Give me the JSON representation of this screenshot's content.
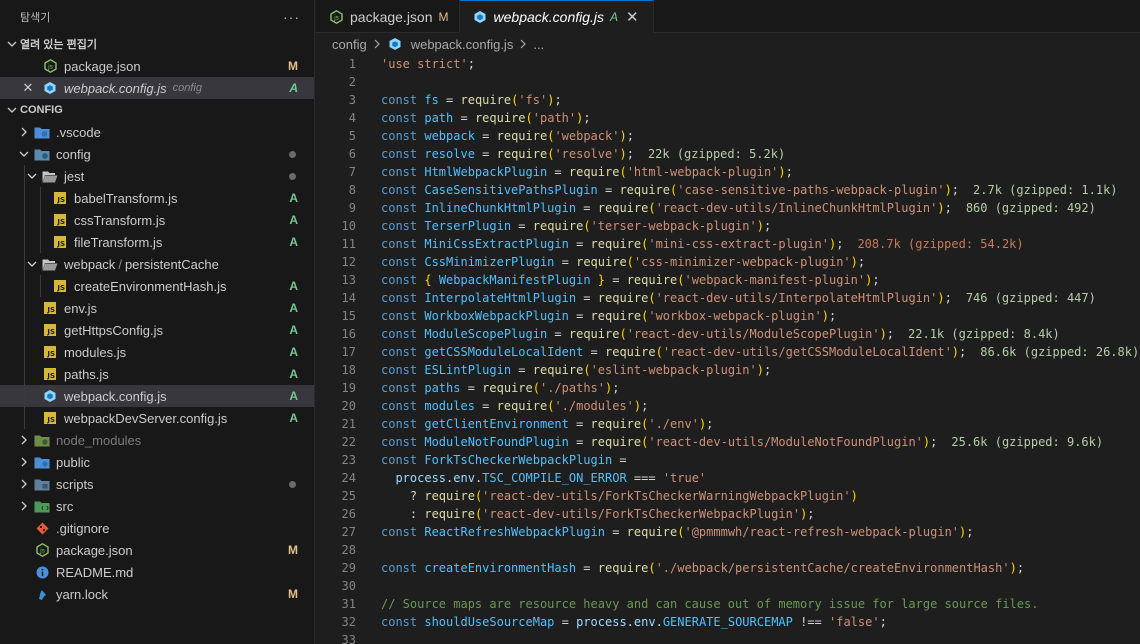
{
  "sidebar": {
    "title": "탐색기",
    "open_editors_label": "열려 있는 편집기",
    "open_editors": [
      {
        "label": "package.json",
        "sub": "",
        "badge": "M"
      },
      {
        "label": "webpack.config.js",
        "sub": "config",
        "badge": "A"
      }
    ],
    "project_label": "CONFIG",
    "tree": [
      {
        "label": ".vscode",
        "badge": ""
      },
      {
        "label": "config",
        "badge": ""
      },
      {
        "label": "jest",
        "badge": ""
      },
      {
        "label": "babelTransform.js",
        "badge": "A"
      },
      {
        "label": "cssTransform.js",
        "badge": "A"
      },
      {
        "label": "fileTransform.js",
        "badge": "A"
      },
      {
        "label": "webpack",
        "label2": "persistentCache",
        "badge": ""
      },
      {
        "label": "createEnvironmentHash.js",
        "badge": "A"
      },
      {
        "label": "env.js",
        "badge": "A"
      },
      {
        "label": "getHttpsConfig.js",
        "badge": "A"
      },
      {
        "label": "modules.js",
        "badge": "A"
      },
      {
        "label": "paths.js",
        "badge": "A"
      },
      {
        "label": "webpack.config.js",
        "badge": "A"
      },
      {
        "label": "webpackDevServer.config.js",
        "badge": "A"
      },
      {
        "label": "node_modules",
        "badge": ""
      },
      {
        "label": "public",
        "badge": ""
      },
      {
        "label": "scripts",
        "badge": ""
      },
      {
        "label": "src",
        "badge": ""
      },
      {
        "label": ".gitignore",
        "badge": ""
      },
      {
        "label": "package.json",
        "badge": "M"
      },
      {
        "label": "README.md",
        "badge": ""
      },
      {
        "label": "yarn.lock",
        "badge": "M"
      }
    ]
  },
  "tabs": [
    {
      "label": "package.json",
      "status": "M"
    },
    {
      "label": "webpack.config.js",
      "status": "A"
    }
  ],
  "breadcrumb": {
    "folder": "config",
    "file": "webpack.config.js",
    "more": "..."
  },
  "editor": {
    "line_numbers": [
      "1",
      "2",
      "3",
      "4",
      "5",
      "6",
      "7",
      "8",
      "9",
      "10",
      "11",
      "12",
      "13",
      "14",
      "15",
      "16",
      "17",
      "18",
      "19",
      "20",
      "21",
      "22",
      "23",
      "24",
      "25",
      "26",
      "27",
      "28",
      "29",
      "30",
      "31",
      "32",
      "33"
    ],
    "import_sizes": {
      "resolve": "22k (gzipped: 5.2k)",
      "case_sensitive": "2.7k (gzipped: 1.1k)",
      "inline_chunk": "860 (gzipped: 492)",
      "mini_css": "208.7k (gzipped: 54.2k)",
      "interpolate": "746 (gzipped: 447)",
      "module_scope": "22.1k (gzipped: 8.4k)",
      "css_module_ident": "86.6k (gzipped: 26.8k)",
      "module_not_found": "25.6k (gzipped: 9.6k)"
    },
    "comment_31": "// Source maps are resource heavy and can cause out of memory issue for large source files."
  },
  "colors": {
    "accent": "#0078d4",
    "modified": "#e2c08d",
    "added": "#73c991",
    "js_icon": "#d7b73a"
  }
}
